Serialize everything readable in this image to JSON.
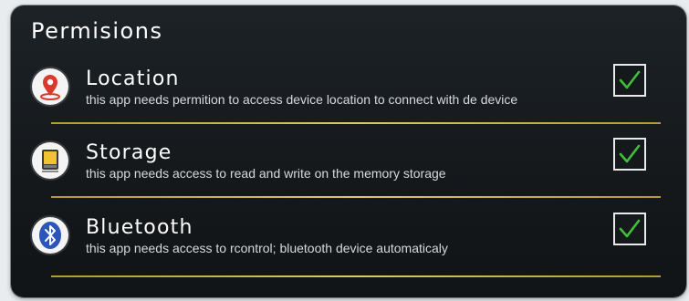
{
  "title": "Permisions",
  "permissions": [
    {
      "name": "Location",
      "description": "this app needs permition to access device location to connect with  de device",
      "checked": true,
      "icon": "location-pin-icon"
    },
    {
      "name": "Storage",
      "description": "this app needs access to read and write on the memory storage",
      "checked": true,
      "icon": "memory-card-icon"
    },
    {
      "name": "Bluetooth",
      "description": "this app needs access to rcontrol; bluetooth device automaticaly",
      "checked": true,
      "icon": "bluetooth-icon"
    }
  ],
  "colors": {
    "panel": "#181c1f",
    "check": "#3fc03a",
    "divider": "#d6b55e",
    "location_pin": "#d93a2b",
    "bluetooth": "#2b55b8"
  }
}
